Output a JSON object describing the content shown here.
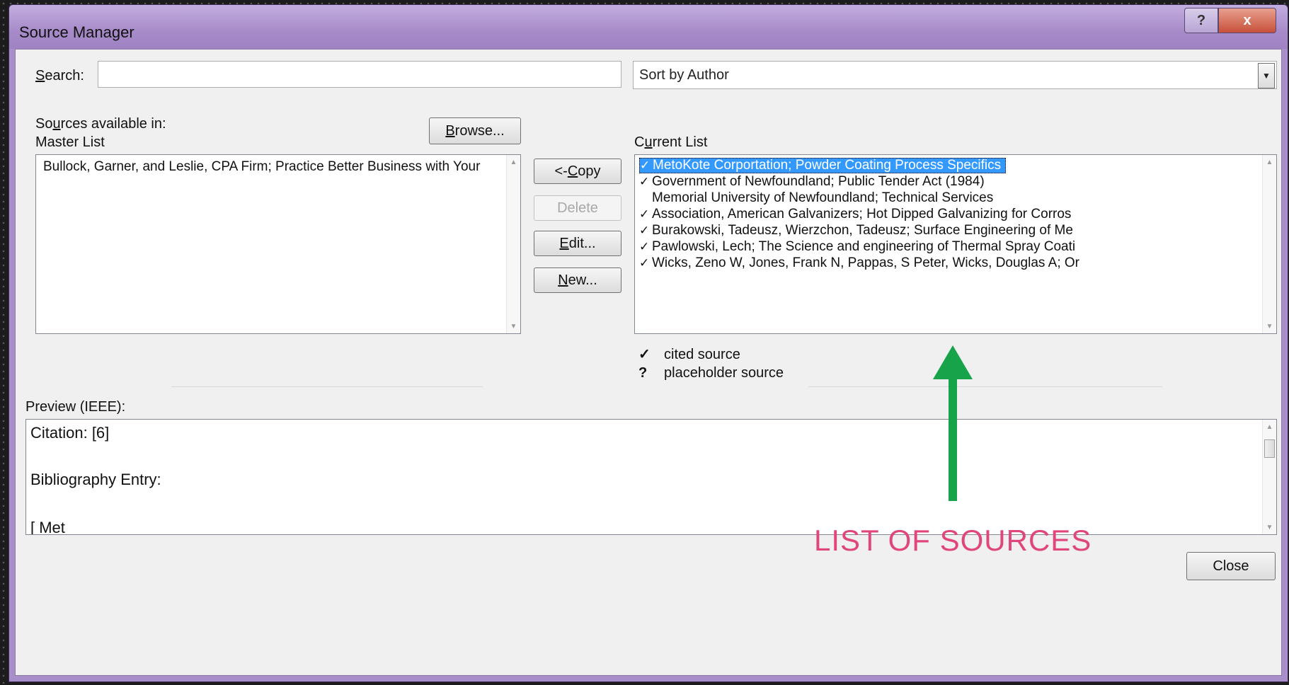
{
  "window": {
    "title": "Source Manager",
    "help_label": "?",
    "close_label": "x"
  },
  "search": {
    "label_pre": "",
    "label_accel": "S",
    "label_post": "earch:",
    "value": "",
    "placeholder": ""
  },
  "sort": {
    "selected": "Sort by Author"
  },
  "master": {
    "label_line1_pre": "So",
    "label_line1_accel": "u",
    "label_line1_post": "rces available in:",
    "label_line2": "Master List",
    "browse_pre": "",
    "browse_accel": "B",
    "browse_post": "rowse...",
    "items": [
      "Bullock, Garner, and Leslie, CPA Firm; Practice Better Business with Your"
    ]
  },
  "actions": {
    "copy_pre": "<- ",
    "copy_accel": "C",
    "copy_post": "opy",
    "delete": "Delete",
    "edit_pre": "",
    "edit_accel": "E",
    "edit_post": "dit...",
    "new_pre": "",
    "new_accel": "N",
    "new_post": "ew..."
  },
  "current": {
    "label_pre": "C",
    "label_accel": "u",
    "label_post": "rrent List",
    "items": [
      {
        "mark": "✓",
        "text": "MetoKote Corportation; Powder Coating Process Specifics",
        "selected": true
      },
      {
        "mark": "✓",
        "text": "Government of Newfoundland; Public Tender Act (1984)",
        "selected": false
      },
      {
        "mark": "",
        "text": "Memorial University of Newfoundland; Technical Services",
        "selected": false
      },
      {
        "mark": "✓",
        "text": "Association, American Galvanizers; Hot Dipped Galvanizing for Corros",
        "selected": false
      },
      {
        "mark": "✓",
        "text": "Burakowski, Tadeusz, Wierzchon, Tadeusz; Surface Engineering of Me",
        "selected": false
      },
      {
        "mark": "✓",
        "text": "Pawlowski, Lech; The Science and engineering of Thermal Spray Coati",
        "selected": false
      },
      {
        "mark": "✓",
        "text": "Wicks, Zeno W, Jones, Frank N, Pappas, S Peter, Wicks, Douglas A; Or",
        "selected": false
      }
    ]
  },
  "legend": {
    "cited_symbol": "✓",
    "cited_label": "cited source",
    "placeholder_symbol": "?",
    "placeholder_label": "placeholder source"
  },
  "preview": {
    "label": "Preview (IEEE):",
    "citation": "Citation:  [6]",
    "bibliography": "Bibliography Entry:",
    "entry_start": "[ Met"
  },
  "footer": {
    "close_label": "Close"
  },
  "annotation": {
    "text": "LIST OF SOURCES",
    "color": "#e0467c",
    "arrow_color": "#16a34a"
  },
  "colors": {
    "selection": "#3399ff",
    "title_bar": "#a88fc9"
  },
  "icons": {
    "dropdown": "chevron-down-icon",
    "cited": "check-icon",
    "placeholder": "question-icon"
  }
}
